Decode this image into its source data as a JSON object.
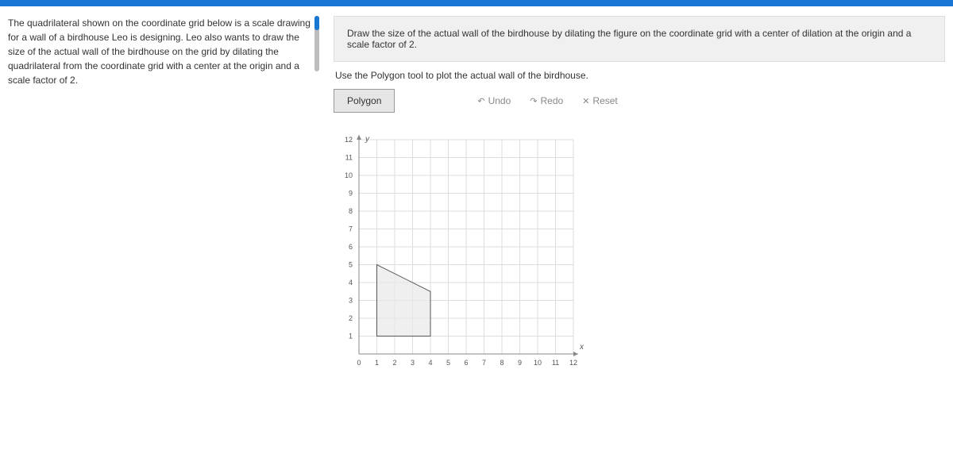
{
  "problem": {
    "text": "The quadrilateral shown on the coordinate grid below is a scale drawing for a wall of a birdhouse Leo is designing. Leo also wants to draw the size of the actual wall of the birdhouse on the grid by dilating the quadrilateral from the coordinate grid with a center at the origin and a scale factor of 2."
  },
  "instruction_box": "Draw the size of the actual wall of the birdhouse by dilating the figure on the coordinate grid with a center of dilation at the origin and a scale factor of 2.",
  "sub_instruction": "Use the Polygon tool to plot the actual wall of the birdhouse.",
  "toolbar": {
    "polygon": "Polygon",
    "undo": "Undo",
    "redo": "Redo",
    "reset": "Reset"
  },
  "chart_data": {
    "type": "scatter",
    "title": "",
    "xlabel": "x",
    "ylabel": "y",
    "xlim": [
      0,
      12
    ],
    "ylim": [
      0,
      12
    ],
    "x_ticks": [
      0,
      1,
      2,
      3,
      4,
      5,
      6,
      7,
      8,
      9,
      10,
      11,
      12
    ],
    "y_ticks": [
      1,
      2,
      3,
      4,
      5,
      6,
      7,
      8,
      9,
      10,
      11,
      12
    ],
    "quadrilateral_vertices": [
      {
        "x": 1,
        "y": 1
      },
      {
        "x": 1,
        "y": 5
      },
      {
        "x": 4,
        "y": 3.5
      },
      {
        "x": 4,
        "y": 1
      }
    ]
  }
}
